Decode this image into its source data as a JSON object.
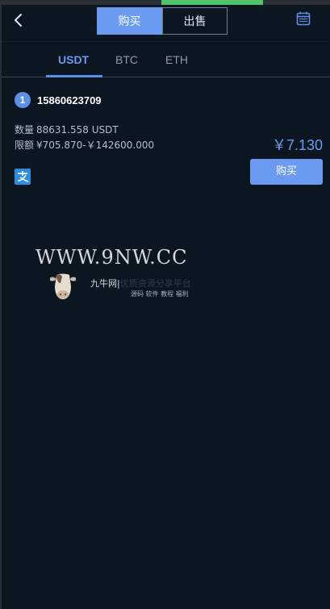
{
  "header": {
    "back_icon": "chevron-left-icon",
    "tabs": [
      {
        "label": "购买",
        "active": true
      },
      {
        "label": "出售",
        "active": false
      }
    ],
    "calendar_icon": "calendar-icon"
  },
  "coin_tabs": [
    "USDT",
    "BTC",
    "ETH"
  ],
  "coin_tabs_active": "USDT",
  "orders": [
    {
      "rank": "1",
      "user_id": "15860623709",
      "quantity_label": "数量",
      "quantity_value": "88631.558 USDT",
      "limit_label": "限额",
      "limit_value": "¥705.870-￥142600.000",
      "price": "￥7.130",
      "payment_icon": "alipay-icon",
      "buy_label": "购买"
    }
  ],
  "watermark": {
    "url": "WWW.9NW.CC",
    "brand": "九牛网",
    "brand_sub": "优质资源分享平台",
    "tags": "源码  软件  教程  福利"
  },
  "colors": {
    "accent": "#6a9bf0",
    "background": "#0b1621"
  }
}
